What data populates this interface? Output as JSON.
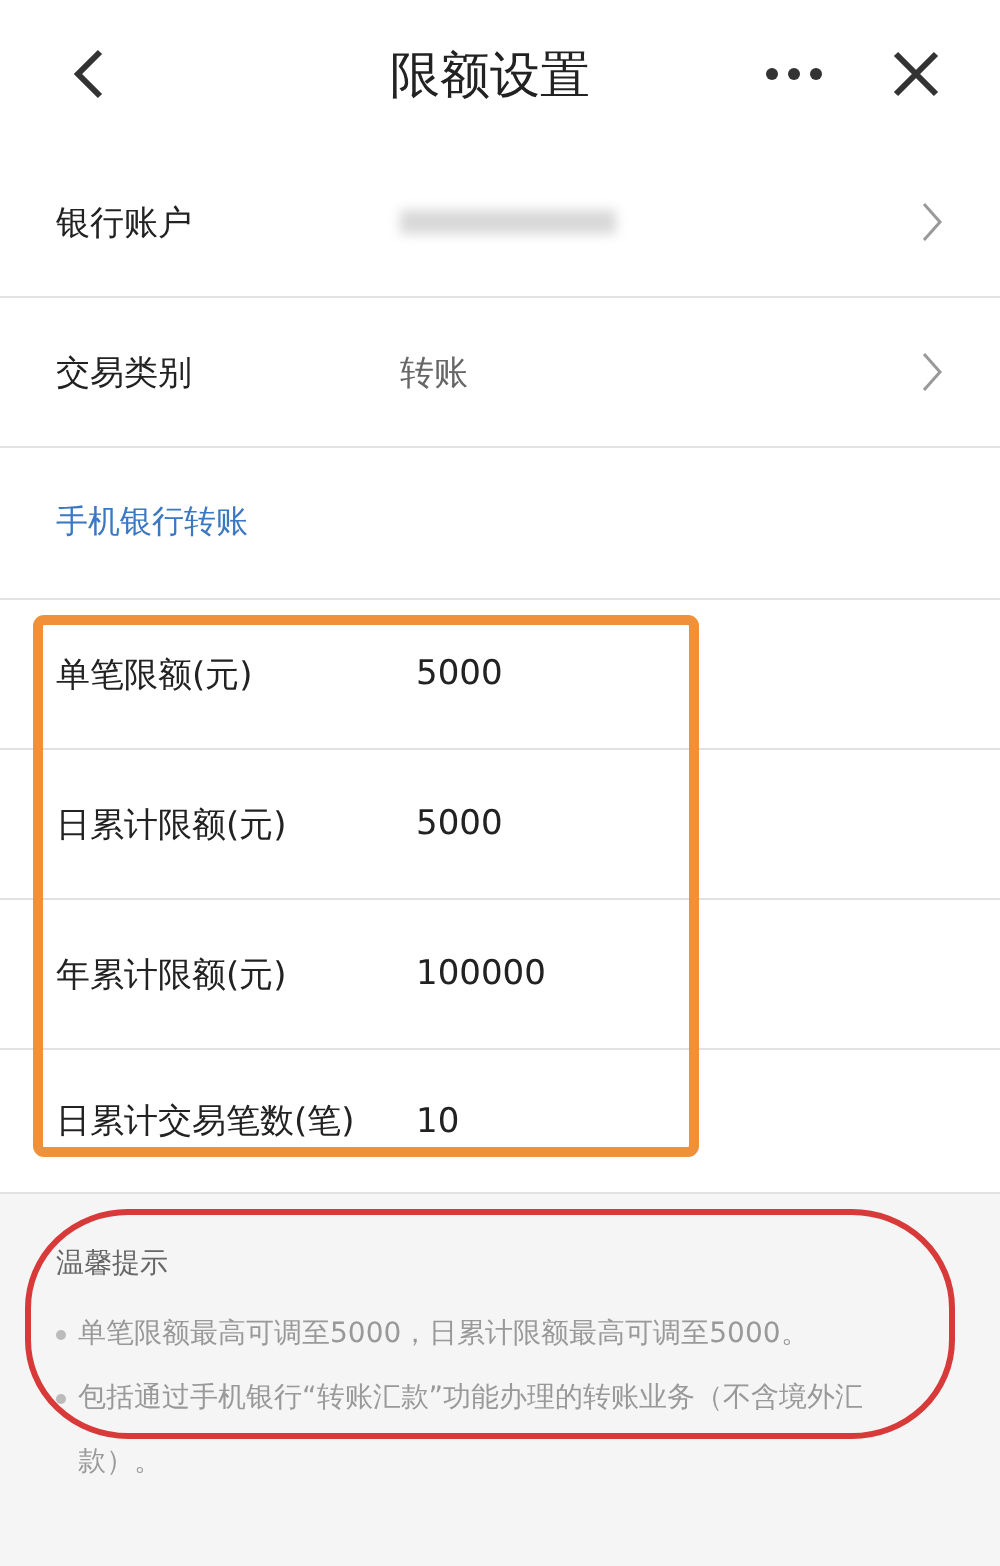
{
  "header": {
    "title": "限额设置"
  },
  "settings": [
    {
      "label": "银行账户",
      "redacted": true
    },
    {
      "label": "交易类别",
      "value": "转账",
      "redacted": false
    }
  ],
  "section": {
    "title": "手机银行转账"
  },
  "limits": [
    {
      "label": "单笔限额(元)",
      "value": "5000"
    },
    {
      "label": "日累计限额(元)",
      "value": "5000"
    },
    {
      "label": "年累计限额(元)",
      "value": "100000"
    },
    {
      "label": "日累计交易笔数(笔)",
      "value": "10"
    }
  ],
  "tips": {
    "title": "温馨提示",
    "items": [
      "单笔限额最高可调至5000，日累计限额最高可调至5000。",
      "包括通过手机银行“转账汇款”功能办理的转账业务（不含境外汇款）。"
    ]
  },
  "annotations": [
    {
      "kind": "frame",
      "color": "#f0913a"
    },
    {
      "kind": "circle",
      "color": "#d83a3a"
    }
  ]
}
